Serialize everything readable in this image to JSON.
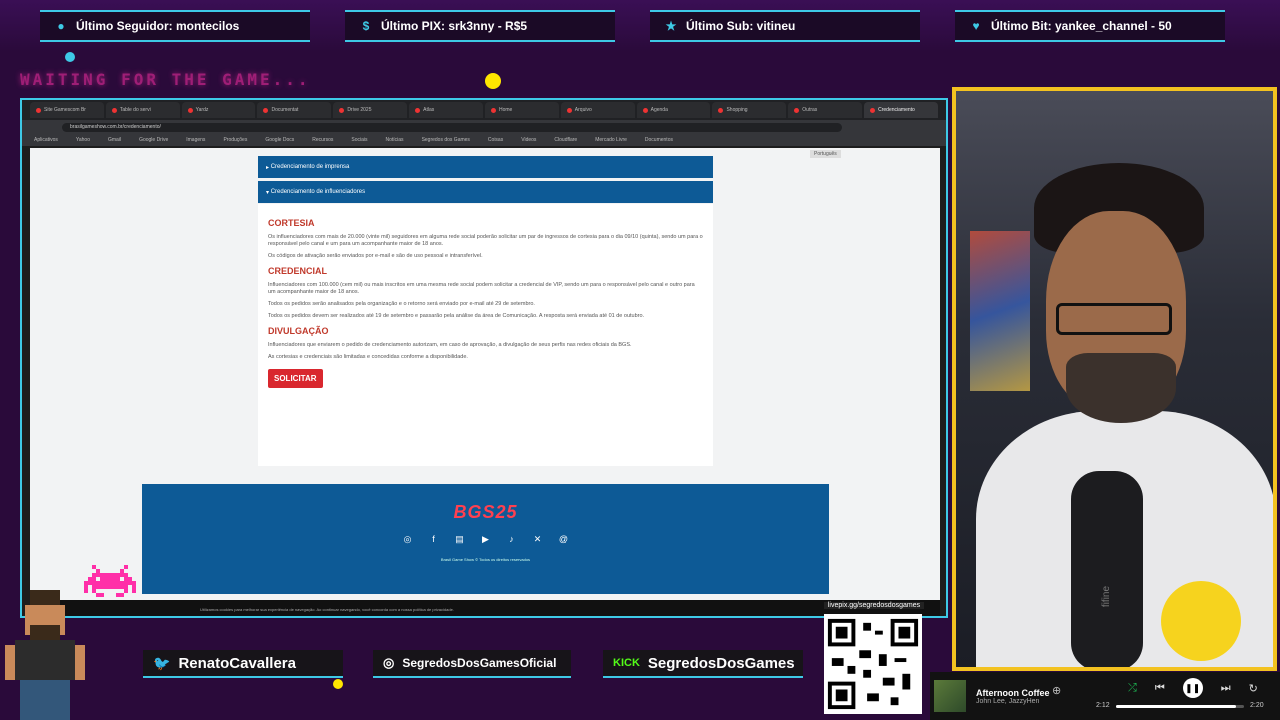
{
  "alerts": [
    {
      "icon": "user-icon",
      "label": "Último Seguidor: montecilos"
    },
    {
      "icon": "dollar-icon",
      "label": "Último PIX: srk3nny - R$5"
    },
    {
      "icon": "star-icon",
      "label": "Último Sub: vitineu"
    },
    {
      "icon": "heart-icon",
      "label": "Último Bit: yankee_channel - 50"
    }
  ],
  "waiting_text": "WAITING FOR THE GAME...",
  "browser": {
    "tabs": [
      "Site Gamescom Br",
      "Table do servi",
      "Yardz",
      "Documentat",
      "Drive 2025",
      "Atlas",
      "Home",
      "Arquivo",
      "Agenda",
      "Shopping",
      "Outras",
      "Credenciamento"
    ],
    "url": "brasilgameshow.com.br/credenciamento/",
    "bookmarks": [
      "Aplicativos",
      "Yahoo",
      "Gmail",
      "Google Drive",
      "Imagens",
      "Produções",
      "Google Docs",
      "Recursos",
      "Sociais",
      "Notícias",
      "Segredos dos Games",
      "Coisas",
      "Videos",
      "Cloudflare",
      "Mercado Livre",
      "Documentos"
    ],
    "language": "Português"
  },
  "page": {
    "accordion": [
      "Credenciamento de imprensa",
      "Credenciamento de influenciadores"
    ],
    "sections": [
      {
        "title": "CORTESIA",
        "paras": [
          "Os influenciadores com mais de 20.000 (vinte mil) seguidores em alguma rede social poderão solicitar um par de ingressos de cortesia para o dia 09/10 (quinta), sendo um para o responsável pelo canal e um para um acompanhante maior de 18 anos.",
          "Os códigos de ativação serão enviados por e-mail e são de uso pessoal e intransferível."
        ]
      },
      {
        "title": "CREDENCIAL",
        "paras": [
          "Influenciadores com 100.000 (cem mil) ou mais inscritos em uma mesma rede social podem solicitar a credencial de VIP, sendo um para o responsável pelo canal e outro para um acompanhante maior de 18 anos.",
          "Todos os pedidos serão analisados pela organização e o retorno será enviado por e-mail até 29 de setembro.",
          "Todos os pedidos devem ser realizados até 19 de setembro e passarão pela análise da área de Comunicação. A resposta será enviada até 01 de outubro."
        ]
      },
      {
        "title": "DIVULGAÇÃO",
        "paras": [
          "Influenciadores que enviarem o pedido de credenciamento autorizam, em caso de aprovação, a divulgação de seus perfis nas redes oficiais da BGS.",
          "As cortesias e credenciais são limitadas e concedidas conforme a disponibilidade."
        ]
      }
    ],
    "request_button": "SOLICITAR",
    "footer_logo": "BGS25",
    "footer_copy": "Brasil Game Show © Todos os direitos reservados",
    "cookie_text": "Utilizamos cookies para melhorar sua experiência de navegação. Ao continuar navegando, você concorda com a nossa política de privacidade."
  },
  "streamer": {
    "twitter": "RenatoCavallera",
    "instagram": "SegredosDosGamesOficial",
    "kick_tag": "KICK",
    "kick": "SegredosDosGames",
    "qr_label": "livepix.gg/segredosdosgames",
    "mic_brand": "fifine"
  },
  "music": {
    "title": "Afternoon Coffee",
    "artist": "John Lee, JazzyHen",
    "elapsed": "2:12",
    "total": "2:20",
    "progress": 0.94
  }
}
